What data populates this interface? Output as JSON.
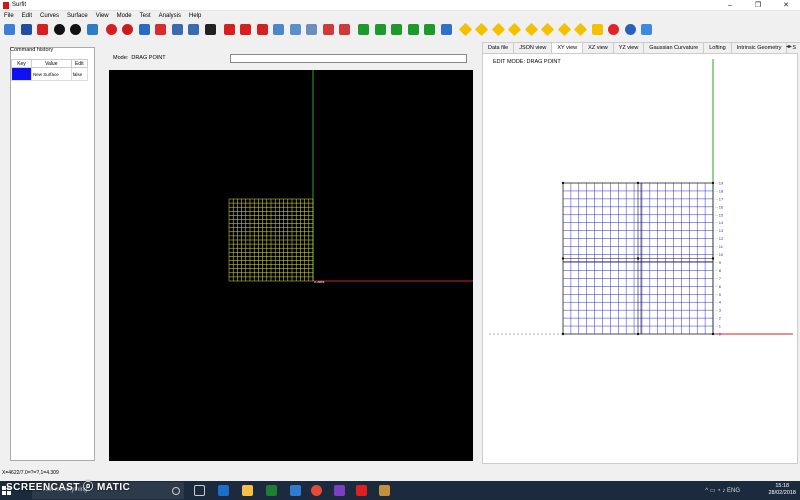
{
  "window": {
    "title": "Surfit"
  },
  "menu": [
    "File",
    "Edit",
    "Curves",
    "Surface",
    "View",
    "Mode",
    "Test",
    "Analysis",
    "Help"
  ],
  "toolbar_icons": [
    {
      "name": "open-icon",
      "color": "#3c7fd6"
    },
    {
      "name": "save-icon",
      "color": "#1f4f9e"
    },
    {
      "name": "close-icon",
      "color": "#d42020"
    },
    {
      "name": "power-icon",
      "color": "#111111"
    },
    {
      "name": "stop-icon",
      "color": "#111111"
    },
    {
      "name": "refresh-icon",
      "color": "#2e7cc7"
    },
    {
      "name": "add-icon",
      "color": "#d42020"
    },
    {
      "name": "no-entry-icon",
      "color": "#c81e1e"
    },
    {
      "name": "move-icon",
      "color": "#2a6bc2"
    },
    {
      "name": "warning-icon",
      "color": "#d82b2b"
    },
    {
      "name": "grid-icon",
      "color": "#3a6bb0"
    },
    {
      "name": "table-icon",
      "color": "#3a6bb0"
    },
    {
      "name": "shuffle-icon",
      "color": "#222222"
    },
    {
      "name": "paint-icon",
      "color": "#d42020"
    },
    {
      "name": "paint2-icon",
      "color": "#d42020"
    },
    {
      "name": "paint3-icon",
      "color": "#d42020"
    },
    {
      "name": "image-icon",
      "color": "#4a86c8"
    },
    {
      "name": "wave-icon",
      "color": "#5b8fc9"
    },
    {
      "name": "shape-icon",
      "color": "#6a8fbf"
    },
    {
      "name": "flag-icon",
      "color": "#d03a3a"
    },
    {
      "name": "flag2-icon",
      "color": "#d03a3a"
    },
    {
      "name": "align-left-icon",
      "color": "#1c9a2c"
    },
    {
      "name": "align-center-icon",
      "color": "#1c9a2c"
    },
    {
      "name": "align-right-icon",
      "color": "#1c9a2c"
    },
    {
      "name": "bars-icon",
      "color": "#1c9a2c"
    },
    {
      "name": "bars2-icon",
      "color": "#1c9a2c"
    },
    {
      "name": "link-icon",
      "color": "#2f70c9"
    },
    {
      "name": "sign1-icon",
      "color": "#f2c200"
    },
    {
      "name": "sign2-icon",
      "color": "#f2c200"
    },
    {
      "name": "sign3-icon",
      "color": "#f2c200"
    },
    {
      "name": "sign4-icon",
      "color": "#f2c200"
    },
    {
      "name": "sign5-icon",
      "color": "#f2c200"
    },
    {
      "name": "sign6-icon",
      "color": "#f2c200"
    },
    {
      "name": "sign7-icon",
      "color": "#f2c200"
    },
    {
      "name": "sign8-icon",
      "color": "#f2c200"
    },
    {
      "name": "minus-icon",
      "color": "#f2c200"
    },
    {
      "name": "alert-icon",
      "color": "#e0252a"
    },
    {
      "name": "circle-icon",
      "color": "#2a60b8"
    },
    {
      "name": "info-icon",
      "color": "#3a8be0"
    }
  ],
  "history": {
    "title": "Command history",
    "headers": [
      "Key",
      "Value",
      "Edit"
    ],
    "rows": [
      {
        "key": "",
        "value": "New Surface",
        "edit": "false"
      }
    ]
  },
  "mode": {
    "label": "Mode:",
    "value": "DRAG POINT",
    "input_value": ""
  },
  "canvas3d": {
    "axis_label": "x-axis"
  },
  "tabs": [
    {
      "label": "Data file"
    },
    {
      "label": "JSON view"
    },
    {
      "label": "XY view",
      "active": true
    },
    {
      "label": "XZ view"
    },
    {
      "label": "YZ view"
    },
    {
      "label": "Gaussian Curvature"
    },
    {
      "label": "Lofting"
    },
    {
      "label": "Intrinsic Geometry"
    },
    {
      "label": "S"
    }
  ],
  "xy_view": {
    "edit_mode_label": "EDIT MODE: DRAG POINT",
    "row_labels": [
      "0",
      "1",
      "2",
      "3",
      "4",
      "5",
      "6",
      "7",
      "8",
      "9",
      "10",
      "11",
      "12",
      "13",
      "14",
      "15",
      "16",
      "17",
      "18",
      "19"
    ]
  },
  "status": {
    "text": "X=4622/7.0=?=?,1=4.309"
  },
  "taskbar": {
    "search_placeholder": "Ask me anything",
    "watermark": "SCREENCAST ⓞ MATIC",
    "time": "15:18",
    "date": "28/02/2018"
  }
}
